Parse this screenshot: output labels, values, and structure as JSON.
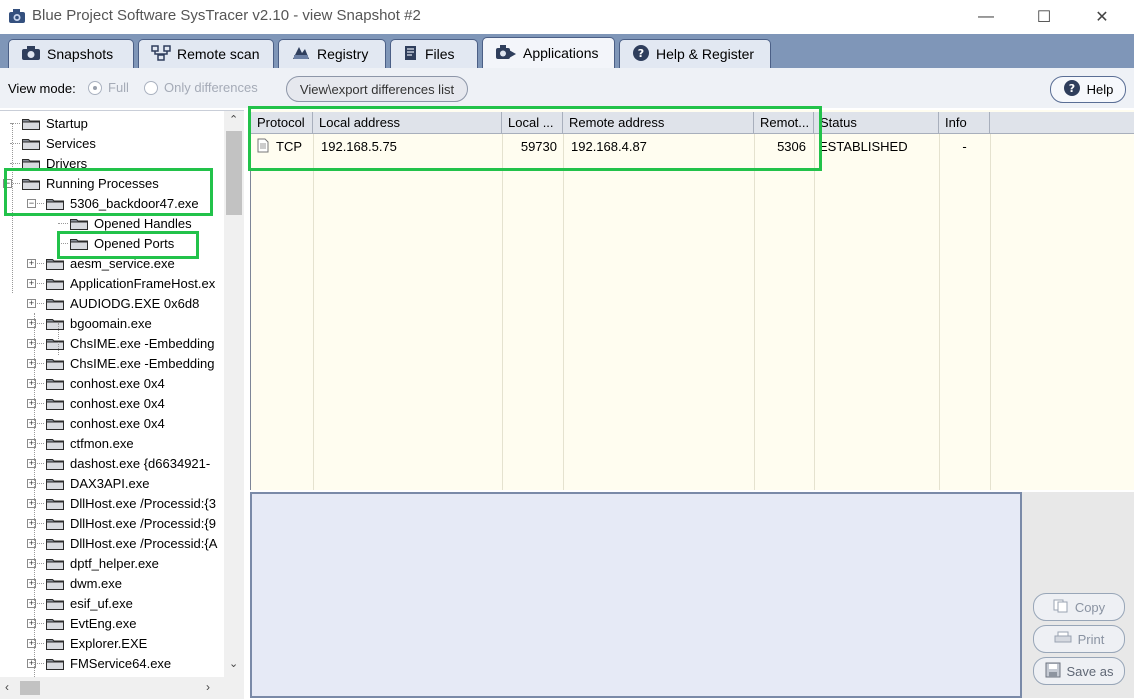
{
  "window": {
    "title": "Blue Project Software SysTracer v2.10 - view Snapshot #2"
  },
  "tabs": [
    {
      "label": "Snapshots",
      "icon": "camera-icon"
    },
    {
      "label": "Remote scan",
      "icon": "network-icon"
    },
    {
      "label": "Registry",
      "icon": "registry-icon"
    },
    {
      "label": "Files",
      "icon": "file-icon"
    },
    {
      "label": "Applications",
      "icon": "applications-icon",
      "active": true
    },
    {
      "label": "Help & Register",
      "icon": "help-icon"
    }
  ],
  "toolbar": {
    "view_mode_label": "View mode:",
    "full_label": "Full",
    "only_diff_label": "Only differences",
    "diff_button": "View\\export differences list",
    "help_button": "Help"
  },
  "tree": {
    "items": [
      {
        "label": "Startup",
        "level": 0
      },
      {
        "label": "Services",
        "level": 0
      },
      {
        "label": "Drivers",
        "level": 0
      },
      {
        "label": "Running Processes",
        "level": 0,
        "expanded": true
      },
      {
        "label": "5306_backdoor47.exe",
        "level": 1,
        "expanded": true
      },
      {
        "label": "Opened Handles",
        "level": 2
      },
      {
        "label": "Opened Ports",
        "level": 2
      },
      {
        "label": "aesm_service.exe",
        "level": 1
      },
      {
        "label": "ApplicationFrameHost.ex",
        "level": 1
      },
      {
        "label": "AUDIODG.EXE 0x6d8",
        "level": 1
      },
      {
        "label": "bgoomain.exe",
        "level": 1
      },
      {
        "label": "ChsIME.exe -Embedding",
        "level": 1
      },
      {
        "label": "ChsIME.exe -Embedding",
        "level": 1
      },
      {
        "label": "conhost.exe 0x4",
        "level": 1
      },
      {
        "label": "conhost.exe 0x4",
        "level": 1
      },
      {
        "label": "conhost.exe 0x4",
        "level": 1
      },
      {
        "label": "ctfmon.exe",
        "level": 1
      },
      {
        "label": "dashost.exe {d6634921-",
        "level": 1
      },
      {
        "label": "DAX3API.exe",
        "level": 1
      },
      {
        "label": "DllHost.exe /Processid:{3",
        "level": 1
      },
      {
        "label": "DllHost.exe /Processid:{9",
        "level": 1
      },
      {
        "label": "DllHost.exe /Processid:{A",
        "level": 1
      },
      {
        "label": "dptf_helper.exe",
        "level": 1
      },
      {
        "label": "dwm.exe",
        "level": 1
      },
      {
        "label": "esif_uf.exe",
        "level": 1
      },
      {
        "label": "EvtEng.exe",
        "level": 1
      },
      {
        "label": "Explorer.EXE",
        "level": 1
      },
      {
        "label": "FMService64.exe",
        "level": 1
      }
    ]
  },
  "ports_table": {
    "columns": [
      "Protocol",
      "Local address",
      "Local ...",
      "Remote address",
      "Remot...",
      "Status",
      "Info"
    ],
    "rows": [
      {
        "protocol": "TCP",
        "local_address": "192.168.5.75",
        "local_port": "59730",
        "remote_address": "192.168.4.87",
        "remote_port": "5306",
        "status": "ESTABLISHED",
        "info": "-"
      }
    ]
  },
  "actions": {
    "copy": "Copy",
    "print": "Print",
    "save_as": "Save as"
  },
  "colors": {
    "tab_bar": "#7f96b8",
    "highlight": "#22c24a",
    "grid_bg": "#fffdf0",
    "detail_bg": "#e6eaf6"
  }
}
